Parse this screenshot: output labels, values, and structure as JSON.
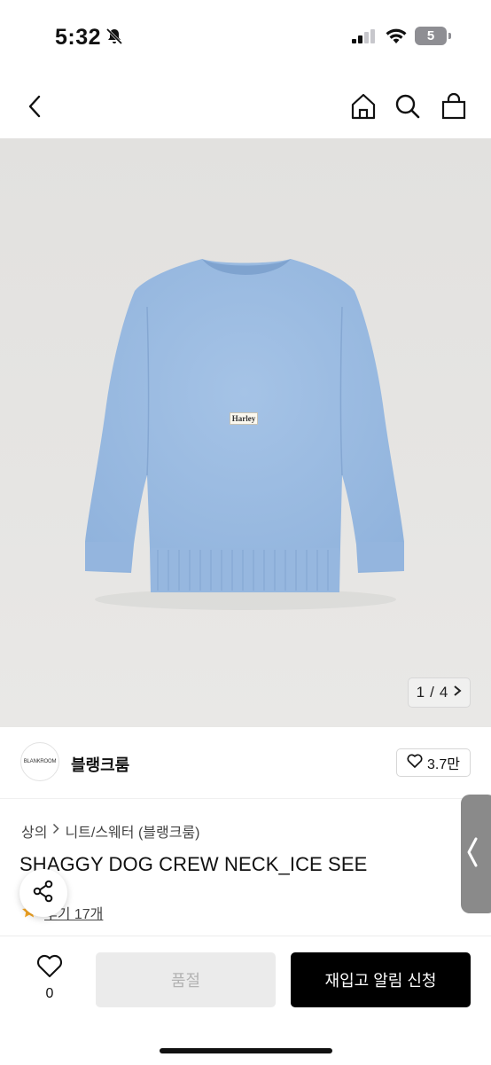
{
  "status_bar": {
    "time": "5:32",
    "battery": "5"
  },
  "image": {
    "counter_current": "1",
    "counter_separator": "/",
    "counter_total": "4",
    "tag_text": "Harley"
  },
  "shop": {
    "avatar_text": "BLANKROOM",
    "name": "블랭크룸",
    "likes": "3.7만"
  },
  "product": {
    "breadcrumb": [
      "상의",
      "니트/스웨터 (블랭크룸)"
    ],
    "title": "SHAGGY DOG CREW NECK_ICE SEE",
    "review_label": "후기 17개"
  },
  "bottom": {
    "wish_count": "0",
    "soldout_label": "품절",
    "notify_label": "재입고 알림 신청"
  },
  "colors": {
    "sweater": "#9cbde3",
    "notify_bg": "#000000",
    "soldout_bg": "#ebebeb",
    "star": "#f5a623"
  }
}
